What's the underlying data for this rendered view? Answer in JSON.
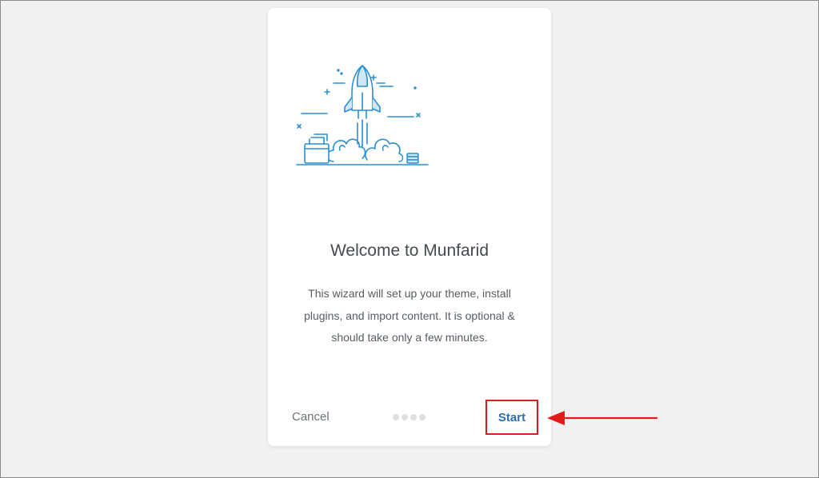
{
  "card": {
    "title": "Welcome to Munfarid",
    "description": "This wizard will set up your theme, install plugins, and import content. It is optional & should take only a few minutes.",
    "cancel_label": "Cancel",
    "start_label": "Start",
    "step_indicator": {
      "total": 4
    }
  },
  "illustration": {
    "name": "rocket-launch-icon"
  },
  "colors": {
    "background": "#f1f1f1",
    "card": "#ffffff",
    "accent": "#2a6fa6",
    "illustration_blue": "#2b8fd0",
    "annotation_red": "#e01b1b"
  }
}
